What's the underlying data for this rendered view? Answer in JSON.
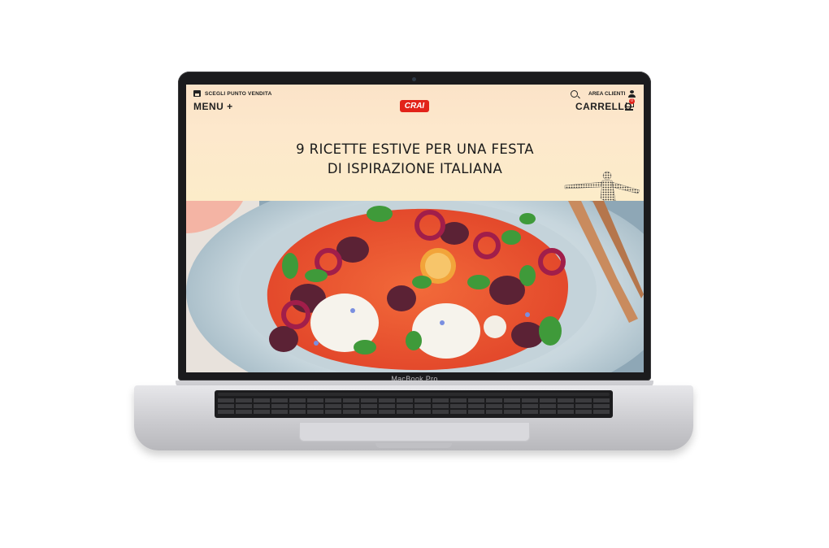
{
  "device": {
    "model_label": "MacBook Pro"
  },
  "header": {
    "store_selector_label": "SCEGLI PUNTO VENDITA",
    "menu_label": "MENU +",
    "logo_text": "CRAI",
    "account_label": "AREA CLIENTI",
    "cart_label": "CARRELLO",
    "cart_count": "0"
  },
  "hero": {
    "title_line1": "9 RICETTE ESTIVE PER UNA FESTA",
    "title_line2": "DI ISPIRAZIONE ITALIANA"
  },
  "colors": {
    "brand_red": "#e2231a",
    "header_bg": "#fde8cc",
    "text": "#1b1b1b"
  },
  "icons": [
    "store-icon",
    "search-icon",
    "user-icon",
    "cart-icon"
  ]
}
